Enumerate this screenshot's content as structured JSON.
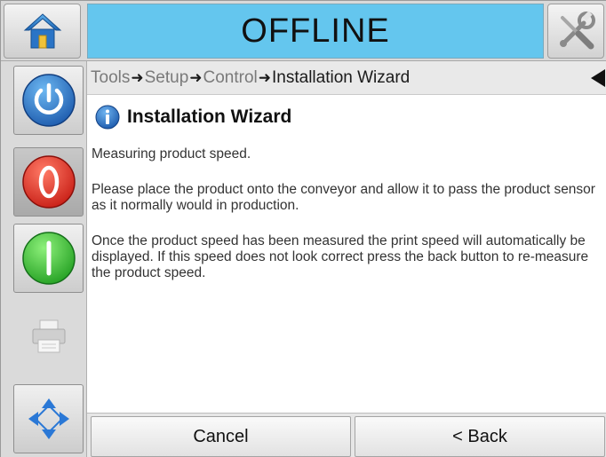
{
  "header": {
    "status": "OFFLINE",
    "status_color": "#64c6ee",
    "home_icon": "home-icon",
    "tools_icon": "tools-icon"
  },
  "sidebar": {
    "items": [
      {
        "name": "power",
        "icon": "power-icon",
        "color": "#1f6fc1"
      },
      {
        "name": "stop",
        "icon": "stop-icon",
        "color": "#e0271e"
      },
      {
        "name": "start",
        "icon": "start-icon",
        "color": "#2fbf2f"
      },
      {
        "name": "print",
        "icon": "printer-icon"
      },
      {
        "name": "navigate",
        "icon": "navigation-arrows-icon",
        "color": "#2a78d6"
      }
    ]
  },
  "breadcrumb": {
    "items": [
      "Tools",
      "Setup",
      "Control",
      "Installation Wizard"
    ]
  },
  "content": {
    "title": "Installation Wizard",
    "info_icon": "info-icon",
    "paragraphs": [
      "Measuring product speed.",
      "Please place the product onto the conveyor and allow it to pass the product sensor as it normally would in production.",
      "Once the product speed has been measured the print speed will automatically be displayed. If this speed does not look correct press the back button to re-measure the product speed."
    ]
  },
  "footer": {
    "cancel_label": "Cancel",
    "back_label": "< Back"
  }
}
